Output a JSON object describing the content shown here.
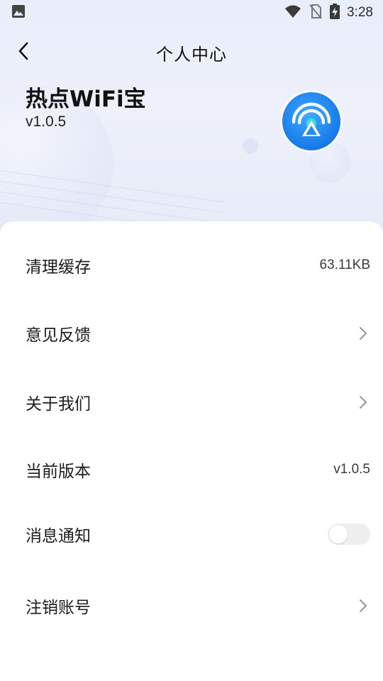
{
  "status_bar": {
    "time": "3:28",
    "icons": [
      "image-icon",
      "wifi-icon",
      "no-sim-icon",
      "battery-charging-icon"
    ]
  },
  "header": {
    "title": "个人中心",
    "back_icon": "chevron-left-icon"
  },
  "app": {
    "name": "热点WiFi宝",
    "version": "v1.0.5",
    "logo_icon": "hotspot-logo-icon"
  },
  "settings": {
    "items": [
      {
        "label": "清理缓存",
        "value": "63.11KB",
        "type": "value"
      },
      {
        "label": "意见反馈",
        "type": "link"
      },
      {
        "label": "关于我们",
        "type": "link"
      },
      {
        "label": "当前版本",
        "value": "v1.0.5",
        "type": "value"
      },
      {
        "label": "消息通知",
        "type": "toggle",
        "enabled": false
      },
      {
        "label": "注销账号",
        "type": "link"
      }
    ]
  },
  "colors": {
    "logo_blue": "#1f8ff0",
    "logo_accent": "#3ee0d0",
    "header_bg": "#e9eefb",
    "toggle_off": "#eeeeee"
  }
}
